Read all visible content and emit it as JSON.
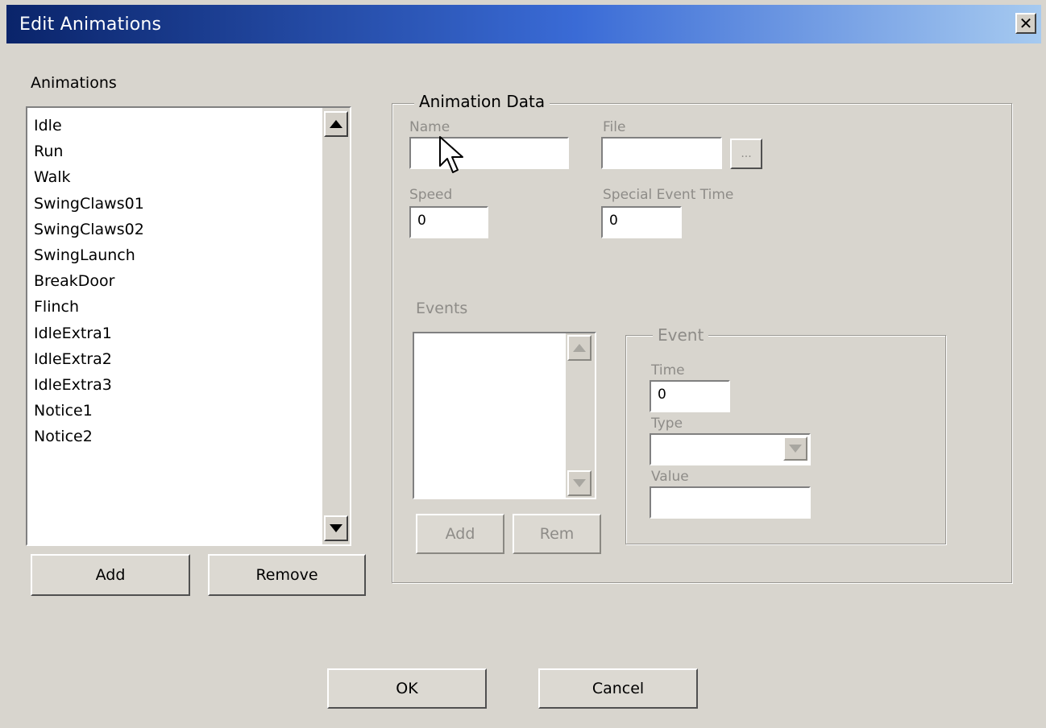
{
  "window": {
    "title": "Edit Animations"
  },
  "animations": {
    "label": "Animations",
    "items": [
      "Idle",
      "Run",
      "Walk",
      "SwingClaws01",
      "SwingClaws02",
      "SwingLaunch",
      "BreakDoor",
      "Flinch",
      "IdleExtra1",
      "IdleExtra2",
      "IdleExtra3",
      "Notice1",
      "Notice2"
    ],
    "add_label": "Add",
    "remove_label": "Remove"
  },
  "animation_data": {
    "legend": "Animation Data",
    "name_label": "Name",
    "name_value": "",
    "file_label": "File",
    "file_value": "",
    "browse_label": "...",
    "speed_label": "Speed",
    "speed_value": "0",
    "special_label": "Special Event Time",
    "special_value": "0",
    "events_label": "Events",
    "events_add_label": "Add",
    "events_rem_label": "Rem"
  },
  "event": {
    "legend": "Event",
    "time_label": "Time",
    "time_value": "0",
    "type_label": "Type",
    "type_value": "",
    "value_label": "Value",
    "value_value": ""
  },
  "footer": {
    "ok_label": "OK",
    "cancel_label": "Cancel"
  }
}
